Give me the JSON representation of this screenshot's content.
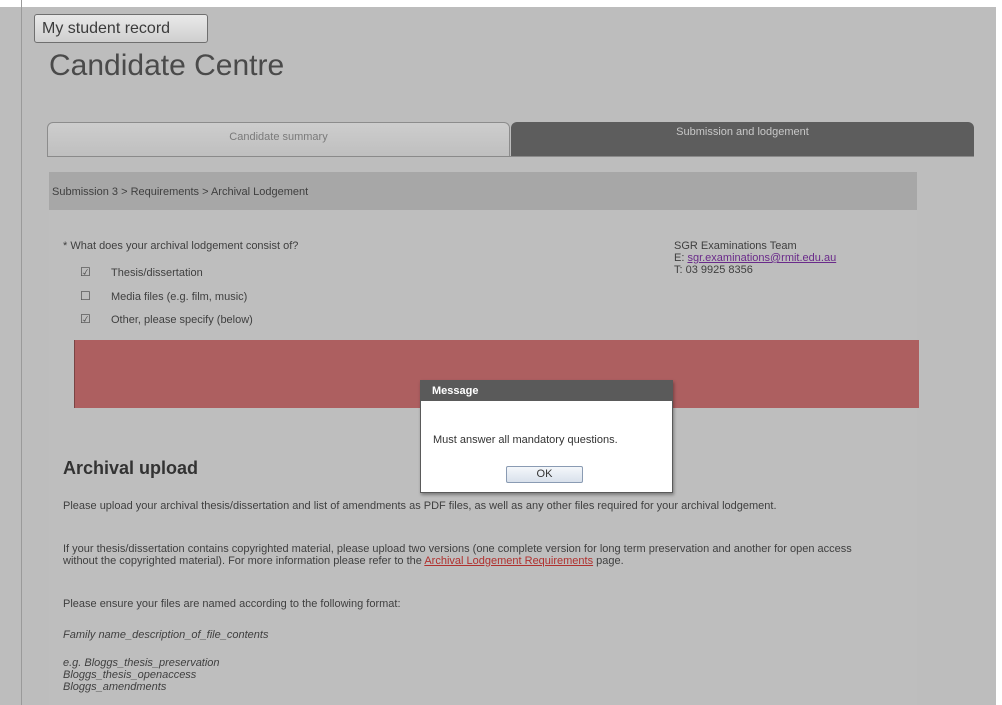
{
  "header": {
    "record_button": "My student record",
    "title": "Candidate Centre"
  },
  "tabs": [
    {
      "label": "Candidate summary",
      "active": false
    },
    {
      "label": "Submission and lodgement",
      "active": true
    }
  ],
  "breadcrumb": "Submission 3 > Requirements > Archival Lodgement",
  "form": {
    "question": "* What does your archival lodgement consist of?",
    "options": [
      {
        "label": "Thesis/dissertation",
        "checked": true,
        "glyph": "☑"
      },
      {
        "label": "Media files (e.g. film, music)",
        "checked": false,
        "glyph": "☐"
      },
      {
        "label": "Other, please specify (below)",
        "checked": true,
        "glyph": "☑"
      }
    ]
  },
  "contact": {
    "team": "SGR Examinations Team",
    "email_prefix": "E: ",
    "email": "sgr.examinations@rmit.edu.au",
    "phone": "T: 03 9925 8356"
  },
  "upload": {
    "title": "Archival upload",
    "para1": "Please upload your archival thesis/dissertation and list of amendments as PDF files, as well as any other files required for your archival lodgement.",
    "para2_text": "If your thesis/dissertation contains copyrighted material, please upload two versions (one complete version for long term preservation and another for open access without the copyrighted material). For more information please refer to the ",
    "para2_link": "Archival Lodgement Requirements",
    "para2_tail": " page.",
    "para3": "Please ensure your files are named according to the following format:",
    "format": "Family name_description_of_file_contents",
    "examples": [
      "e.g. Bloggs_thesis_preservation",
      "Bloggs_thesis_openaccess",
      "Bloggs_amendments"
    ]
  },
  "dialog": {
    "title": "Message",
    "message": "Must answer all mandatory questions.",
    "ok": "OK"
  },
  "colors": {
    "error_band": "#ad5f60",
    "active_tab": "#5d5d5d",
    "link": "#b0302e"
  }
}
